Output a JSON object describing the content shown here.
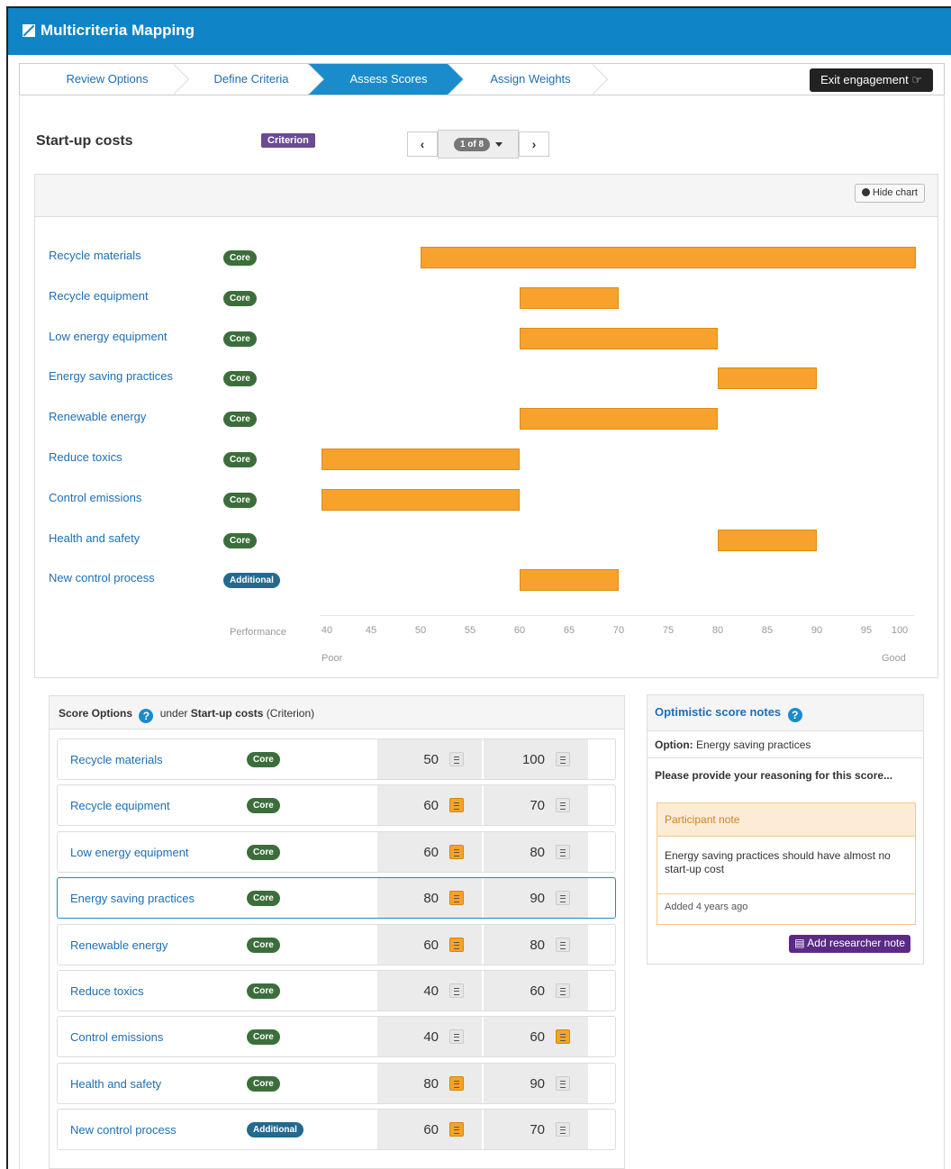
{
  "app": {
    "title": "Multicriteria Mapping"
  },
  "wizard": {
    "steps": [
      "Review Options",
      "Define Criteria",
      "Assess Scores",
      "Assign Weights"
    ],
    "active": "Assess Scores",
    "exit_label": "Exit engagement"
  },
  "header": {
    "title": "Start-up costs",
    "type_badge": "Criterion",
    "pager_label": "1 of 8"
  },
  "chart_panel": {
    "hide_label": "Hide chart"
  },
  "chart_data": {
    "type": "bar",
    "orientation": "horizontal-range",
    "categories": [
      "Recycle materials",
      "Recycle equipment",
      "Low energy equipment",
      "Energy saving practices",
      "Renewable energy",
      "Reduce toxics",
      "Control emissions",
      "Health and safety",
      "New control process"
    ],
    "tags": [
      "Core",
      "Core",
      "Core",
      "Core",
      "Core",
      "Core",
      "Core",
      "Core",
      "Additional"
    ],
    "low": [
      50,
      60,
      60,
      80,
      60,
      40,
      40,
      80,
      60
    ],
    "high": [
      100,
      70,
      80,
      90,
      80,
      60,
      60,
      90,
      70
    ],
    "xlim": [
      40,
      100
    ],
    "xticks": [
      40,
      45,
      50,
      55,
      60,
      65,
      70,
      75,
      80,
      85,
      90,
      95,
      100
    ],
    "xlabel": "Performance",
    "x_left_label": "Poor",
    "x_right_label": "Good",
    "bar_color": "#f7a22c"
  },
  "score_panel": {
    "title": "Score Options",
    "under_text": "under",
    "criterion": "Start-up costs",
    "criterion_type": "(Criterion)",
    "rows": [
      {
        "name": "Recycle materials",
        "tag": "Core",
        "low": "50",
        "high": "100",
        "low_note": false,
        "high_note": false
      },
      {
        "name": "Recycle equipment",
        "tag": "Core",
        "low": "60",
        "high": "70",
        "low_note": true,
        "high_note": false
      },
      {
        "name": "Low energy equipment",
        "tag": "Core",
        "low": "60",
        "high": "80",
        "low_note": true,
        "high_note": false
      },
      {
        "name": "Energy saving practices",
        "tag": "Core",
        "low": "80",
        "high": "90",
        "low_note": true,
        "high_note": false
      },
      {
        "name": "Renewable energy",
        "tag": "Core",
        "low": "60",
        "high": "80",
        "low_note": true,
        "high_note": false
      },
      {
        "name": "Reduce toxics",
        "tag": "Core",
        "low": "40",
        "high": "60",
        "low_note": false,
        "high_note": false
      },
      {
        "name": "Control emissions",
        "tag": "Core",
        "low": "40",
        "high": "60",
        "low_note": false,
        "high_note": true
      },
      {
        "name": "Health and safety",
        "tag": "Core",
        "low": "80",
        "high": "90",
        "low_note": true,
        "high_note": false
      },
      {
        "name": "New control process",
        "tag": "Additional",
        "low": "60",
        "high": "70",
        "low_note": true,
        "high_note": false
      }
    ]
  },
  "notes_panel": {
    "title": "Optimistic score notes",
    "option_label": "Option:",
    "option_value": "Energy saving practices",
    "prompt": "Please provide your reasoning for this score...",
    "note_header": "Participant note",
    "note_text": "Energy saving practices should have almost no start-up cost",
    "note_meta": "Added 4 years ago",
    "add_button": "Add researcher note"
  }
}
